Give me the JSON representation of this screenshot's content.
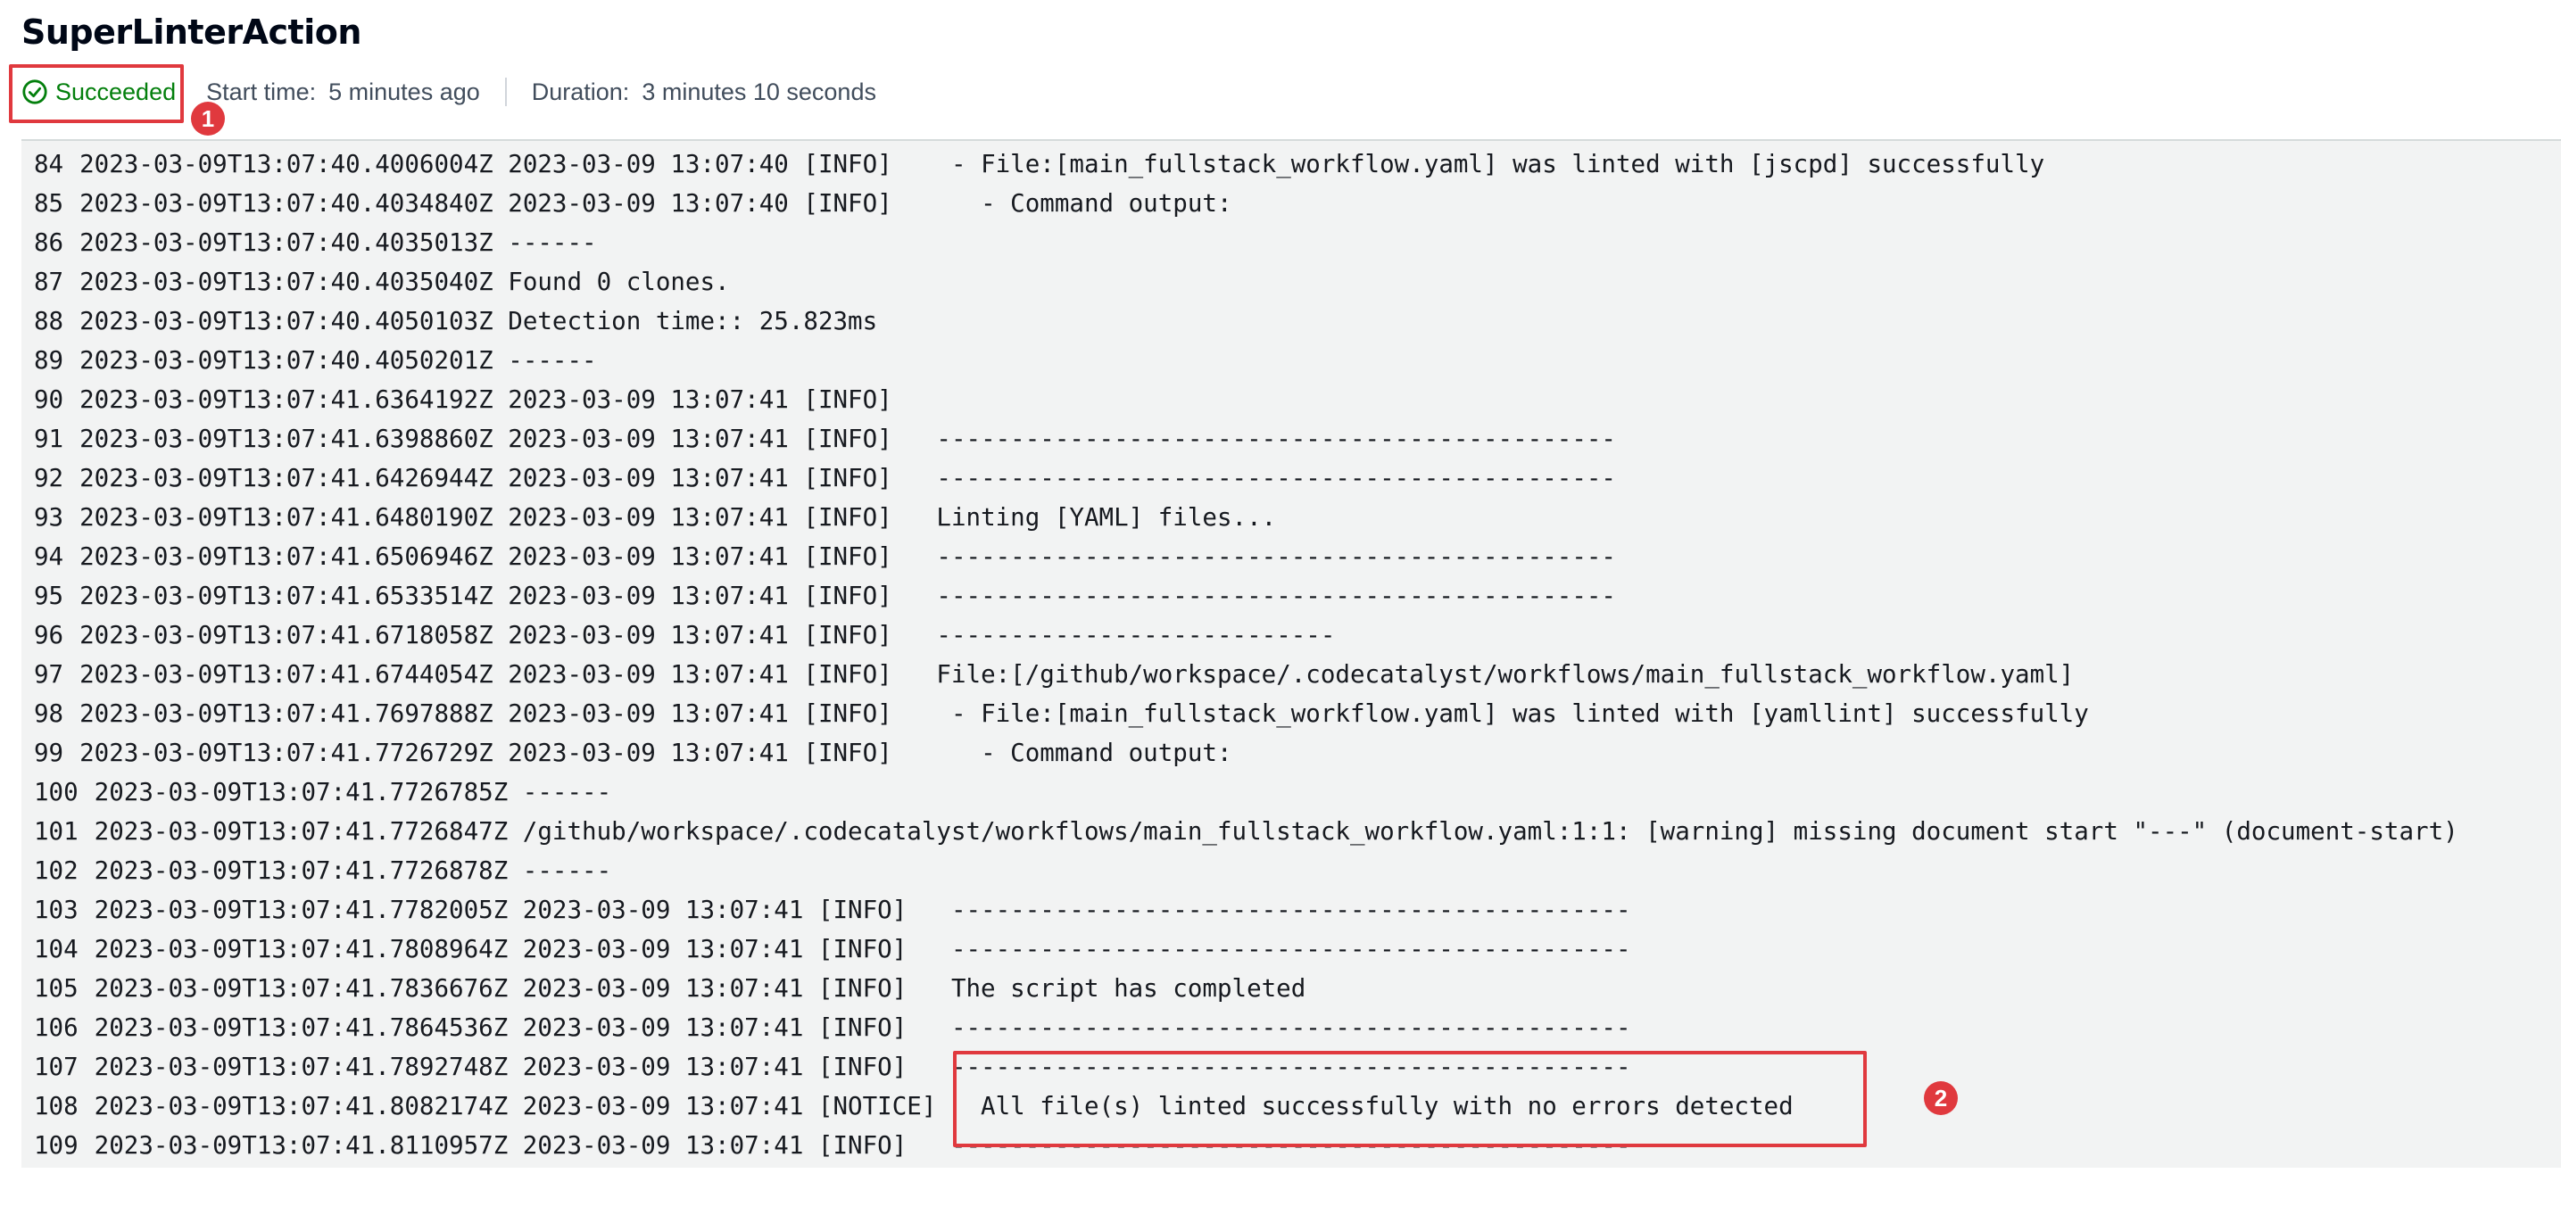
{
  "header": {
    "title": "SuperLinterAction",
    "status": "Succeeded",
    "start_label": "Start time:",
    "start_value": "5 minutes ago",
    "duration_label": "Duration:",
    "duration_value": "3 minutes 10 seconds"
  },
  "colors": {
    "success": "#037f0c",
    "annotation": "#e0393e",
    "log_background": "#f2f3f3"
  },
  "annotations": {
    "marker_1": "1",
    "marker_2": "2"
  },
  "log": [
    {
      "num": "84",
      "text": "2023-03-09T13:07:40.4006004Z 2023-03-09 13:07:40 [INFO]    - File:[main_fullstack_workflow.yaml] was linted with [jscpd] successfully"
    },
    {
      "num": "85",
      "text": "2023-03-09T13:07:40.4034840Z 2023-03-09 13:07:40 [INFO]      - Command output:"
    },
    {
      "num": "86",
      "text": "2023-03-09T13:07:40.4035013Z ------"
    },
    {
      "num": "87",
      "text": "2023-03-09T13:07:40.4035040Z Found 0 clones."
    },
    {
      "num": "88",
      "text": "2023-03-09T13:07:40.4050103Z Detection time:: 25.823ms"
    },
    {
      "num": "89",
      "text": "2023-03-09T13:07:40.4050201Z ------"
    },
    {
      "num": "90",
      "text": "2023-03-09T13:07:41.6364192Z 2023-03-09 13:07:41 [INFO]"
    },
    {
      "num": "91",
      "text": "2023-03-09T13:07:41.6398860Z 2023-03-09 13:07:41 [INFO]   ----------------------------------------------"
    },
    {
      "num": "92",
      "text": "2023-03-09T13:07:41.6426944Z 2023-03-09 13:07:41 [INFO]   ----------------------------------------------"
    },
    {
      "num": "93",
      "text": "2023-03-09T13:07:41.6480190Z 2023-03-09 13:07:41 [INFO]   Linting [YAML] files..."
    },
    {
      "num": "94",
      "text": "2023-03-09T13:07:41.6506946Z 2023-03-09 13:07:41 [INFO]   ----------------------------------------------"
    },
    {
      "num": "95",
      "text": "2023-03-09T13:07:41.6533514Z 2023-03-09 13:07:41 [INFO]   ----------------------------------------------"
    },
    {
      "num": "96",
      "text": "2023-03-09T13:07:41.6718058Z 2023-03-09 13:07:41 [INFO]   ---------------------------"
    },
    {
      "num": "97",
      "text": "2023-03-09T13:07:41.6744054Z 2023-03-09 13:07:41 [INFO]   File:[/github/workspace/.codecatalyst/workflows/main_fullstack_workflow.yaml]"
    },
    {
      "num": "98",
      "text": "2023-03-09T13:07:41.7697888Z 2023-03-09 13:07:41 [INFO]    - File:[main_fullstack_workflow.yaml] was linted with [yamllint] successfully"
    },
    {
      "num": "99",
      "text": "2023-03-09T13:07:41.7726729Z 2023-03-09 13:07:41 [INFO]      - Command output:"
    },
    {
      "num": "100",
      "text": "2023-03-09T13:07:41.7726785Z ------"
    },
    {
      "num": "101",
      "text": "2023-03-09T13:07:41.7726847Z /github/workspace/.codecatalyst/workflows/main_fullstack_workflow.yaml:1:1: [warning] missing document start \"---\" (document-start)"
    },
    {
      "num": "102",
      "text": "2023-03-09T13:07:41.7726878Z ------"
    },
    {
      "num": "103",
      "text": "2023-03-09T13:07:41.7782005Z 2023-03-09 13:07:41 [INFO]   ----------------------------------------------"
    },
    {
      "num": "104",
      "text": "2023-03-09T13:07:41.7808964Z 2023-03-09 13:07:41 [INFO]   ----------------------------------------------"
    },
    {
      "num": "105",
      "text": "2023-03-09T13:07:41.7836676Z 2023-03-09 13:07:41 [INFO]   The script has completed"
    },
    {
      "num": "106",
      "text": "2023-03-09T13:07:41.7864536Z 2023-03-09 13:07:41 [INFO]   ----------------------------------------------"
    },
    {
      "num": "107",
      "text": "2023-03-09T13:07:41.7892748Z 2023-03-09 13:07:41 [INFO]   ----------------------------------------------"
    },
    {
      "num": "108",
      "text": "2023-03-09T13:07:41.8082174Z 2023-03-09 13:07:41 [NOTICE]   All file(s) linted successfully with no errors detected"
    },
    {
      "num": "109",
      "text": "2023-03-09T13:07:41.8110957Z 2023-03-09 13:07:41 [INFO]   ----------------------------------------------"
    }
  ]
}
